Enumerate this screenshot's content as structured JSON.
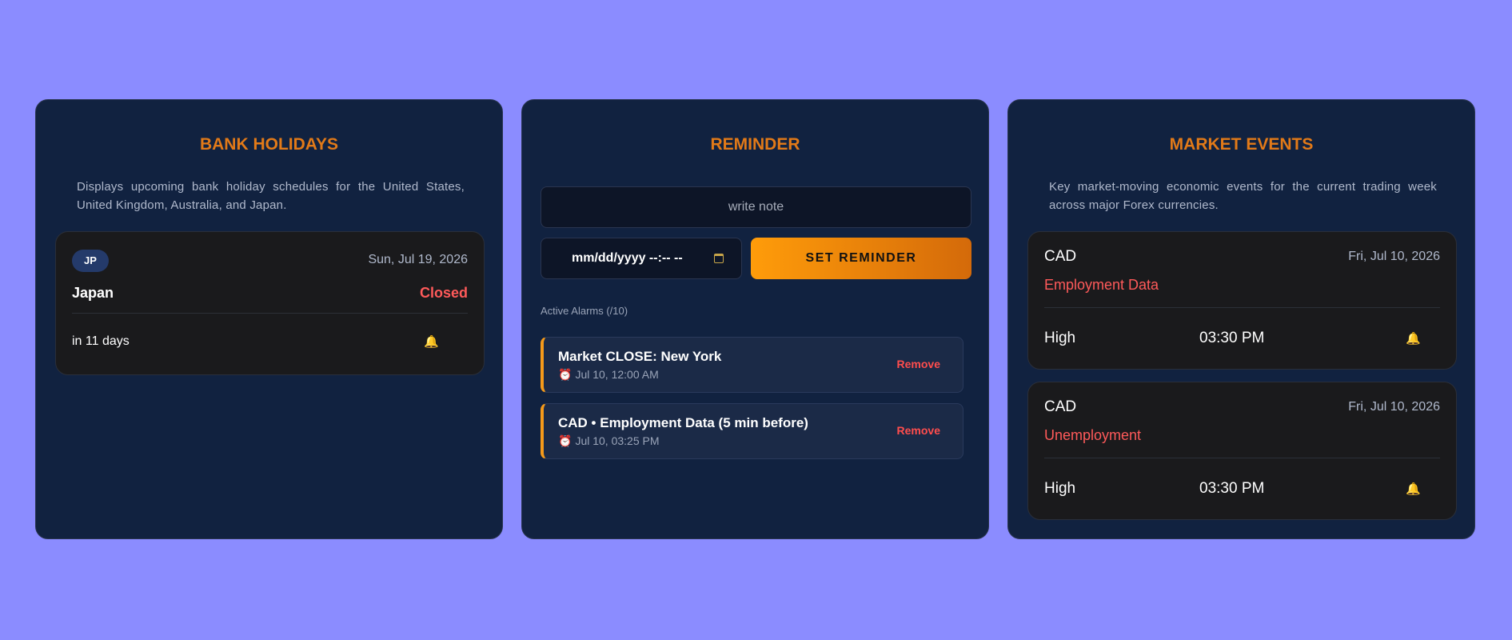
{
  "bank_holidays": {
    "title": "BANK HOLIDAYS",
    "description": "Displays upcoming bank holiday schedules for the United States, United Kingdom, Australia, and Japan.",
    "item": {
      "badge": "JP",
      "date": "Sun, Jul 19, 2026",
      "country": "Japan",
      "status": "Closed",
      "countdown": "in 11 days",
      "icon": "bell-icon"
    }
  },
  "reminder": {
    "title": "REMINDER",
    "note_placeholder": "write note",
    "datetime_placeholder": "mm/dd/yyyy --:-- --",
    "set_button": "SET REMINDER",
    "active_label": "Active Alarms (/10)",
    "alarms": [
      {
        "title": "Market CLOSE: New York",
        "time": "Jul 10, 12:00 AM",
        "remove": "Remove"
      },
      {
        "title": "CAD • Employment Data (5 min before)",
        "time": "Jul 10, 03:25 PM",
        "remove": "Remove"
      }
    ]
  },
  "market_events": {
    "title": "MARKET EVENTS",
    "description": "Key market-moving economic events for the current trading week across major Forex currencies.",
    "events": [
      {
        "currency": "CAD",
        "date": "Fri, Jul 10, 2026",
        "name": "Employment Data",
        "impact": "High",
        "time": "03:30 PM"
      },
      {
        "currency": "CAD",
        "date": "Fri, Jul 10, 2026",
        "name": "Unemployment",
        "impact": "High",
        "time": "03:30 PM"
      }
    ]
  },
  "colors": {
    "background": "#8b8cff",
    "card": "#112240",
    "accent": "#e27a18",
    "danger": "#ff5a5a"
  }
}
